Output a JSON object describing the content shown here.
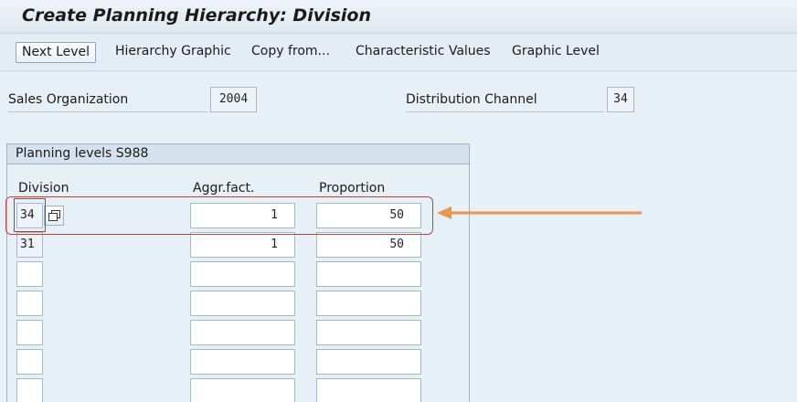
{
  "title": "Create Planning Hierarchy: Division",
  "toolbar": {
    "next_level": "Next Level",
    "hierarchy_graphic": "Hierarchy Graphic",
    "copy_from": "Copy from...",
    "characteristic_values": "Characteristic Values",
    "graphic_level": "Graphic Level"
  },
  "header_fields": {
    "sales_org_label": "Sales Organization",
    "sales_org_value": "2004",
    "dist_channel_label": "Distribution Channel",
    "dist_channel_value": "34"
  },
  "panel": {
    "title": "Planning levels S988",
    "columns": {
      "division": "Division",
      "aggr_fact": "Aggr.fact.",
      "proportion": "Proportion"
    },
    "rows": [
      {
        "division": "34",
        "aggr_fact": "1",
        "proportion": "50"
      },
      {
        "division": "31",
        "aggr_fact": "1",
        "proportion": "50"
      },
      {
        "division": "",
        "aggr_fact": "",
        "proportion": ""
      },
      {
        "division": "",
        "aggr_fact": "",
        "proportion": ""
      },
      {
        "division": "",
        "aggr_fact": "",
        "proportion": ""
      },
      {
        "division": "",
        "aggr_fact": "",
        "proportion": ""
      },
      {
        "division": "",
        "aggr_fact": "",
        "proportion": ""
      }
    ]
  },
  "icons": {
    "value_help": "value-help-icon",
    "annotation_arrow": "left-arrow-icon"
  },
  "colors": {
    "highlight": "#b5453d",
    "arrow": "#e8954f",
    "background": "#e8f0f7"
  }
}
